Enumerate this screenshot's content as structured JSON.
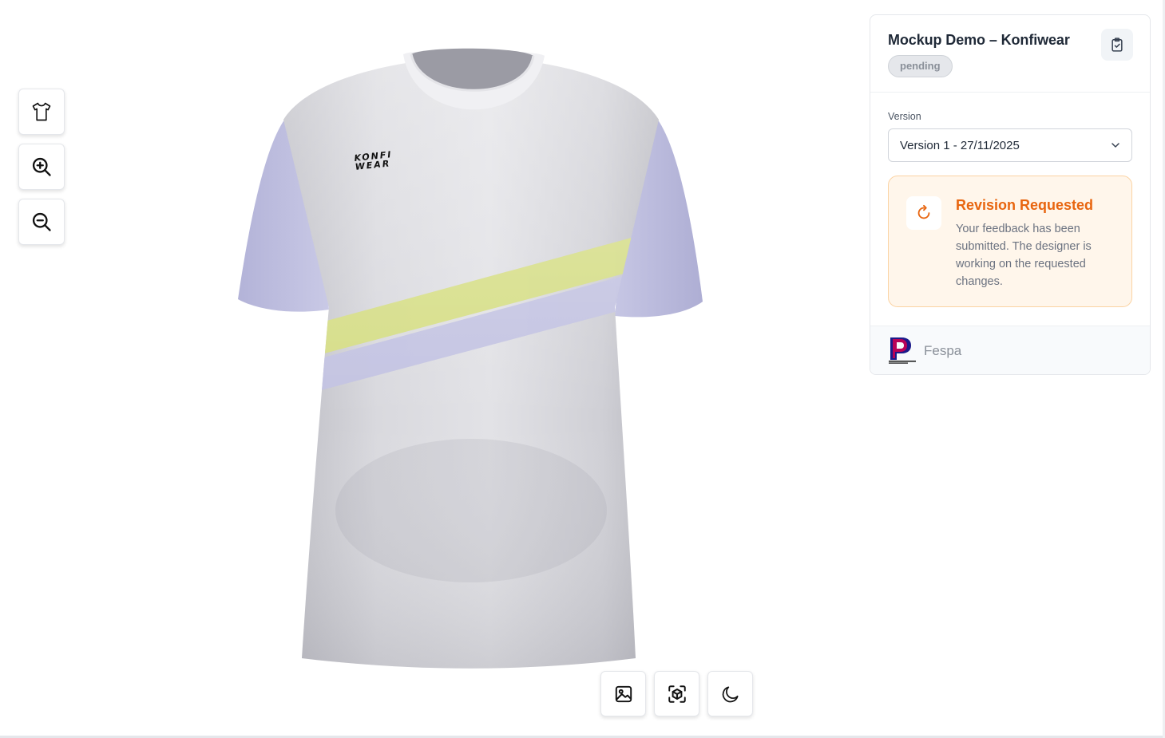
{
  "app": {
    "title": "Mockup Demo – Konfiwear",
    "status": "pending"
  },
  "viewer": {
    "shirt_logo_line1": "KONFI",
    "shirt_logo_line2": "WEAR",
    "tools": [
      {
        "name": "shirt-view",
        "icon": "shirt-icon"
      },
      {
        "name": "zoom-in",
        "icon": "zoom-in-icon"
      },
      {
        "name": "zoom-out",
        "icon": "zoom-out-icon"
      }
    ],
    "bottom_tools": [
      {
        "name": "image",
        "icon": "image-icon"
      },
      {
        "name": "ar-view",
        "icon": "3d-scan-icon"
      },
      {
        "name": "dark-mode",
        "icon": "moon-icon"
      }
    ]
  },
  "panel": {
    "version_label": "Version",
    "version_value": "Version 1 - 27/11/2025",
    "revision_title": "Revision Requested",
    "revision_text": "Your feedback has been submitted. The designer is working on the requested changes.",
    "brand_name": "Fespa"
  },
  "colors": {
    "accent_orange": "#e8650f",
    "revision_bg": "#fff6eb",
    "shirt_sleeve": "#bcbcdf",
    "stripe_yellow": "#d5dd82",
    "stripe_lavender": "#c0c0e0"
  }
}
